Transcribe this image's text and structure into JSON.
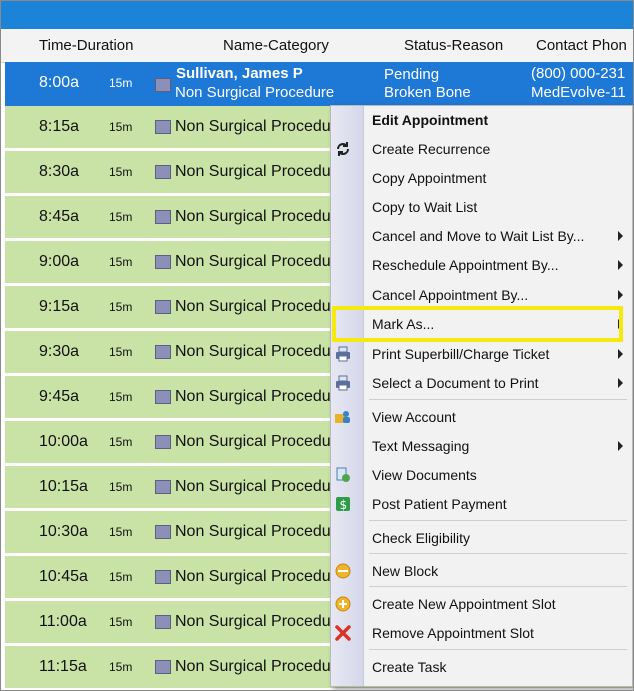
{
  "columns": {
    "time_duration": "Time-Duration",
    "name_category": "Name-Category",
    "status_reason": "Status-Reason",
    "contact_phone": "Contact Phon"
  },
  "selected_row": {
    "time": "8:00a",
    "duration": "15m",
    "patient_name": "Sullivan, James P",
    "category": "Non Surgical Procedure",
    "status": "Pending",
    "reason": "Broken Bone",
    "phone": "(800) 000-231",
    "contact_org": "MedEvolve-11"
  },
  "rows": [
    {
      "time": "8:15a",
      "duration": "15m",
      "name": "Non Surgical Procedu"
    },
    {
      "time": "8:30a",
      "duration": "15m",
      "name": "Non Surgical Procedu"
    },
    {
      "time": "8:45a",
      "duration": "15m",
      "name": "Non Surgical Procedu"
    },
    {
      "time": "9:00a",
      "duration": "15m",
      "name": "Non Surgical Procedu"
    },
    {
      "time": "9:15a",
      "duration": "15m",
      "name": "Non Surgical Procedu"
    },
    {
      "time": "9:30a",
      "duration": "15m",
      "name": "Non Surgical Procedu"
    },
    {
      "time": "9:45a",
      "duration": "15m",
      "name": "Non Surgical Procedu"
    },
    {
      "time": "10:00a",
      "duration": "15m",
      "name": "Non Surgical Procedu"
    },
    {
      "time": "10:15a",
      "duration": "15m",
      "name": "Non Surgical Procedu"
    },
    {
      "time": "10:30a",
      "duration": "15m",
      "name": "Non Surgical Procedu"
    },
    {
      "time": "10:45a",
      "duration": "15m",
      "name": "Non Surgical Procedu"
    },
    {
      "time": "11:00a",
      "duration": "15m",
      "name": "Non Surgical Procedu"
    },
    {
      "time": "11:15a",
      "duration": "15m",
      "name": "Non Surgical Procedu"
    }
  ],
  "context_menu": [
    {
      "label": "Edit Appointment",
      "icon": "",
      "submenu": false
    },
    {
      "label": "Create Recurrence",
      "icon": "recurrence-icon",
      "submenu": false
    },
    {
      "label": "Copy Appointment",
      "icon": "",
      "submenu": false
    },
    {
      "label": "Copy to Wait List",
      "icon": "",
      "submenu": false
    },
    {
      "label": "Cancel and Move to Wait List By...",
      "icon": "",
      "submenu": true
    },
    {
      "label": "Reschedule Appointment By...",
      "icon": "",
      "submenu": true
    },
    {
      "label": "Cancel Appointment By...",
      "icon": "",
      "submenu": true
    },
    {
      "label": "Mark As...",
      "icon": "",
      "submenu": true
    },
    {
      "label": "Print Superbill/Charge Ticket",
      "icon": "printer-icon",
      "submenu": true
    },
    {
      "label": "Select a Document to Print",
      "icon": "printer-icon",
      "submenu": true
    },
    {
      "label": "View Account",
      "icon": "account-icon",
      "submenu": false
    },
    {
      "label": "Text Messaging",
      "icon": "",
      "submenu": true
    },
    {
      "label": "View Documents",
      "icon": "documents-icon",
      "submenu": false
    },
    {
      "label": "Post Patient Payment",
      "icon": "payment-icon",
      "submenu": false
    },
    {
      "label": "Check Eligibility",
      "icon": "",
      "submenu": false
    },
    {
      "label": "New Block",
      "icon": "block-icon",
      "submenu": false
    },
    {
      "label": "Create New Appointment Slot",
      "icon": "slot-icon",
      "submenu": false
    },
    {
      "label": "Remove Appointment Slot",
      "icon": "remove-icon",
      "submenu": false
    },
    {
      "label": "Create Task",
      "icon": "",
      "submenu": false
    }
  ],
  "colors": {
    "selected_row": "#1d78d6",
    "row_fill": "#c9e2a6",
    "highlight": "#f6e90e",
    "title_bar": "#1b84d9"
  }
}
